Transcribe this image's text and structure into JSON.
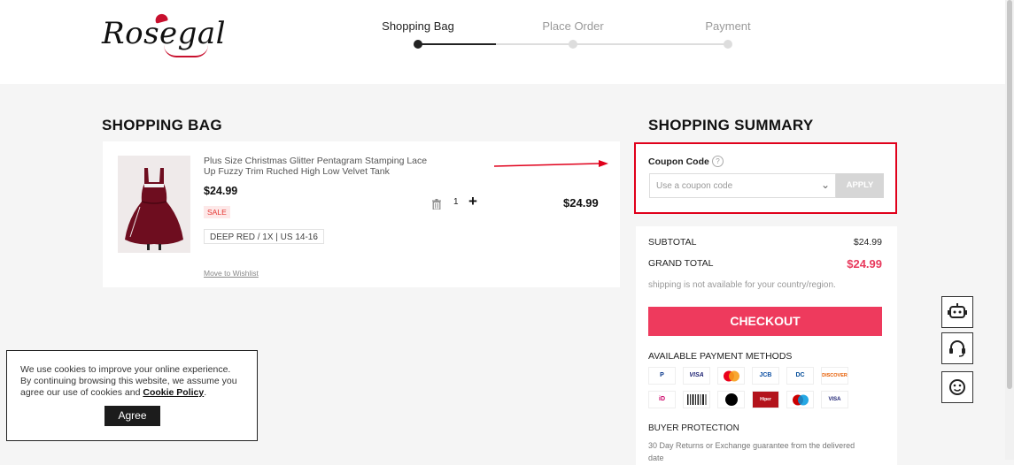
{
  "brand": {
    "logo_text": "Rosegal"
  },
  "steps": [
    {
      "label": "Shopping Bag",
      "active": true
    },
    {
      "label": "Place Order",
      "active": false
    },
    {
      "label": "Payment",
      "active": false
    }
  ],
  "bag": {
    "title": "SHOPPING BAG",
    "item": {
      "name": "Plus Size Christmas Glitter Pentagram Stamping Lace Up Fuzzy Trim Ruched High Low Velvet Tank",
      "price": "$24.99",
      "badge": "SALE",
      "variant": "DEEP RED / 1X | US 14-16",
      "quantity": "1",
      "line_total": "$24.99",
      "wishlist_link": "Move to Wishlist"
    }
  },
  "summary": {
    "title": "SHOPPING SUMMARY",
    "coupon": {
      "label": "Coupon Code",
      "help_icon": "?",
      "placeholder": "Use a coupon code",
      "apply_label": "APPLY"
    },
    "subtotal_label": "SUBTOTAL",
    "subtotal_value": "$24.99",
    "grand_total_label": "GRAND TOTAL",
    "grand_total_value": "$24.99",
    "shipping_note": "shipping is not available for your country/region.",
    "checkout_label": "CHECKOUT",
    "payment_title": "AVAILABLE PAYMENT METHODS",
    "payment_methods": [
      {
        "name": "PayPal",
        "color": "#003087"
      },
      {
        "name": "VISA",
        "color": "#1a1f71"
      },
      {
        "name": "Mastercard",
        "color": "#eb001b"
      },
      {
        "name": "JCB",
        "color": "#0b4ea2"
      },
      {
        "name": "Diners Club",
        "color": "#004a97"
      },
      {
        "name": "DISCOVER",
        "color": "#e65c00"
      },
      {
        "name": "iDEAL",
        "color": "#cc0066"
      },
      {
        "name": "Boleto",
        "color": "#222222"
      },
      {
        "name": "Elo",
        "color": "#000000"
      },
      {
        "name": "Hipercard",
        "color": "#b3131b"
      },
      {
        "name": "Maestro",
        "color": "#cc0000"
      },
      {
        "name": "VISA Electron",
        "color": "#1a1f71"
      }
    ],
    "buyer_protection_title": "BUYER PROTECTION",
    "buyer_protection_text": "30 Day Returns or Exchange guarantee from the delivered date"
  },
  "side_buttons": [
    "robot-icon",
    "headset-icon",
    "face-icon"
  ],
  "cookie": {
    "text": "We use cookies to improve your online experience. By continuing browsing this website, we assume you agree our use of cookies and",
    "link": "Cookie Policy",
    "agree_label": "Agree"
  },
  "colors": {
    "accent": "#ee3a5d",
    "highlight_border": "#e0001b",
    "price_red": "#e8395c"
  }
}
